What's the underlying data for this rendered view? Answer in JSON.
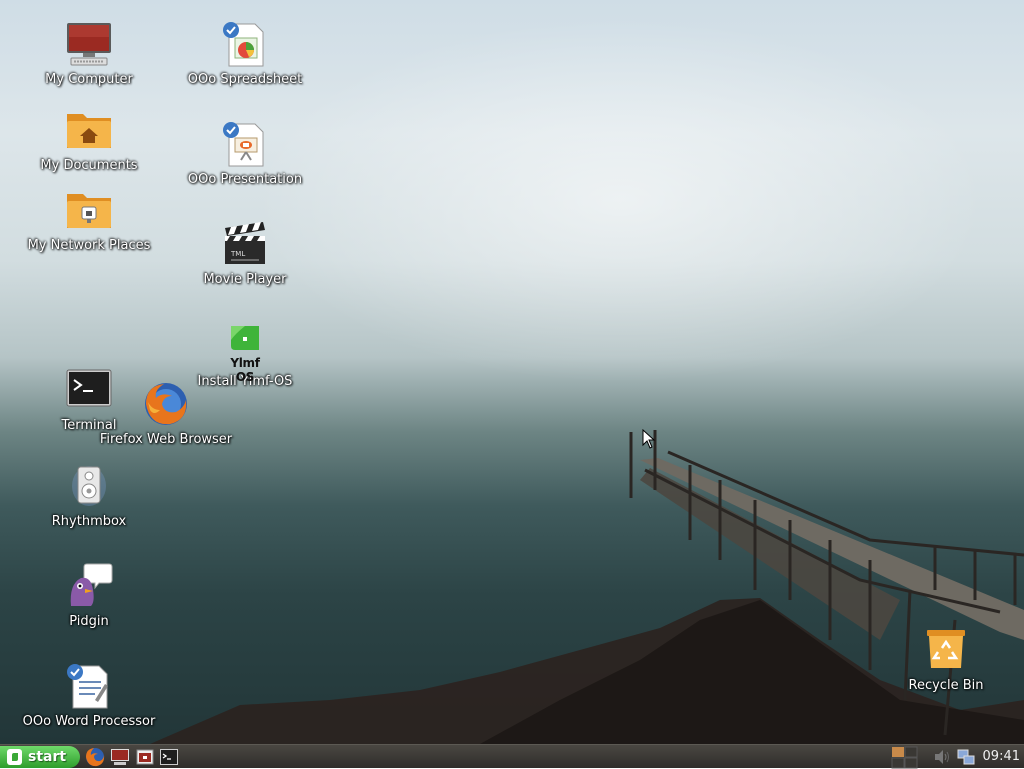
{
  "desktop": {
    "icons": [
      {
        "id": "my_computer",
        "label": "My Computer",
        "icon": "computer-icon"
      },
      {
        "id": "my_documents",
        "label": "My Documents",
        "icon": "home-folder-icon"
      },
      {
        "id": "my_network_places",
        "label": "My Network Places",
        "icon": "network-folder-icon"
      },
      {
        "id": "terminal",
        "label": "Terminal",
        "icon": "terminal-icon"
      },
      {
        "id": "rhythmbox",
        "label": "Rhythmbox",
        "icon": "speaker-icon"
      },
      {
        "id": "pidgin",
        "label": "Pidgin",
        "icon": "pidgin-icon"
      },
      {
        "id": "ooo_word",
        "label": "OOo Word Processor",
        "icon": "word-document-icon"
      },
      {
        "id": "ooo_spreadsheet",
        "label": "OOo Spreadsheet",
        "icon": "spreadsheet-icon"
      },
      {
        "id": "ooo_presentation",
        "label": "OOo Presentation",
        "icon": "presentation-icon"
      },
      {
        "id": "movie_player",
        "label": "Movie Player",
        "icon": "clapperboard-icon"
      },
      {
        "id": "install_ylmf",
        "label": "Install Ylmf-OS",
        "icon": "ylmf-os-icon",
        "logo_text": "Ylmf OS"
      },
      {
        "id": "firefox",
        "label": "Firefox Web Browser",
        "icon": "firefox-icon"
      },
      {
        "id": "recycle_bin",
        "label": "Recycle Bin",
        "icon": "recycle-bin-icon"
      }
    ]
  },
  "taskbar": {
    "start_label": "start",
    "quick_launch": [
      "firefox-icon",
      "computer-icon",
      "app-icon",
      "terminal-icon"
    ],
    "tray": [
      "workspace-switcher-icon",
      "volume-icon",
      "network-icon"
    ],
    "clock": "09:41"
  },
  "colors": {
    "start_green": "#3aa837",
    "taskbar": "#3a3834",
    "folder_orange": "#f0a838"
  }
}
